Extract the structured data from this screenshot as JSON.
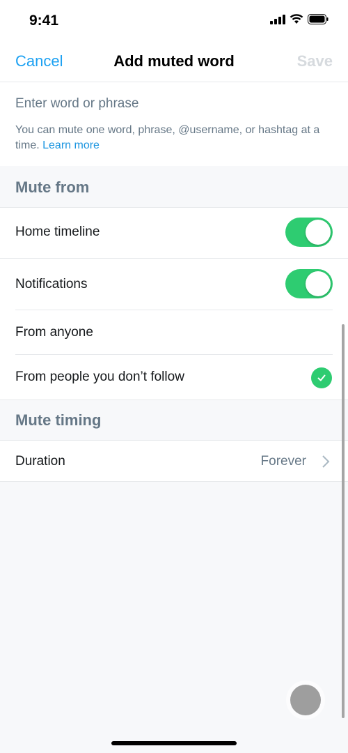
{
  "status_bar": {
    "time": "9:41",
    "icons": [
      "signal-icon",
      "wifi-icon",
      "battery-icon"
    ]
  },
  "nav": {
    "cancel_label": "Cancel",
    "title": "Add muted word",
    "save_label": "Save"
  },
  "input": {
    "value": "",
    "placeholder": "Enter word or phrase"
  },
  "help": {
    "text": "You can mute one word, phrase, @username, or hashtag at a time.",
    "link": "Learn more"
  },
  "mute_from": {
    "header": "Mute from",
    "home_timeline": {
      "label": "Home timeline",
      "on": true
    },
    "notifications": {
      "label": "Notifications",
      "on": true
    },
    "from_anyone": {
      "label": "From anyone",
      "selected": false
    },
    "from_not_following": {
      "label": "From people you don’t follow",
      "selected": true
    }
  },
  "mute_timing": {
    "header": "Mute timing",
    "duration": {
      "label": "Duration",
      "value": "Forever"
    }
  },
  "colors": {
    "accent": "#1da1f2",
    "toggle_on": "#2ecc71",
    "secondary_text": "#657786"
  }
}
